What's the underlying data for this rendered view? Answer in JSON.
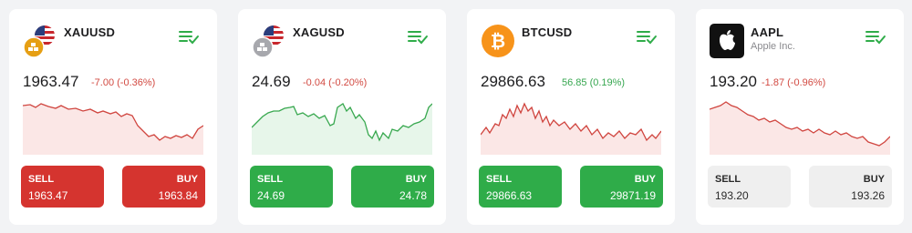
{
  "cards": [
    {
      "symbol": "XAUUSD",
      "icon": "gold-bars-us-flag-icon",
      "price": "1963.47",
      "change": "-7.00 (-0.36%)",
      "direction": "down",
      "sell_label": "SELL",
      "sell_price": "1963.47",
      "buy_label": "BUY",
      "buy_price": "1963.84"
    },
    {
      "symbol": "XAGUSD",
      "icon": "silver-bars-us-flag-icon",
      "price": "24.69",
      "change": "-0.04 (-0.20%)",
      "direction": "down",
      "sell_label": "SELL",
      "sell_price": "24.69",
      "buy_label": "BUY",
      "buy_price": "24.78"
    },
    {
      "symbol": "BTCUSD",
      "icon": "bitcoin-icon",
      "price": "29866.63",
      "change": "56.85 (0.19%)",
      "direction": "up",
      "sell_label": "SELL",
      "sell_price": "29866.63",
      "buy_label": "BUY",
      "buy_price": "29871.19"
    },
    {
      "symbol": "AAPL",
      "subtitle": "Apple Inc.",
      "icon": "apple-logo-icon",
      "price": "193.20",
      "change": "-1.87 (-0.96%)",
      "direction": "down",
      "sell_label": "SELL",
      "sell_price": "193.20",
      "buy_label": "BUY",
      "buy_price": "193.26"
    }
  ],
  "colors": {
    "red": "#d5342f",
    "green": "#2fac49",
    "gray": "#efefef",
    "line_red": "#d0453f",
    "line_green": "#38a84f"
  }
}
